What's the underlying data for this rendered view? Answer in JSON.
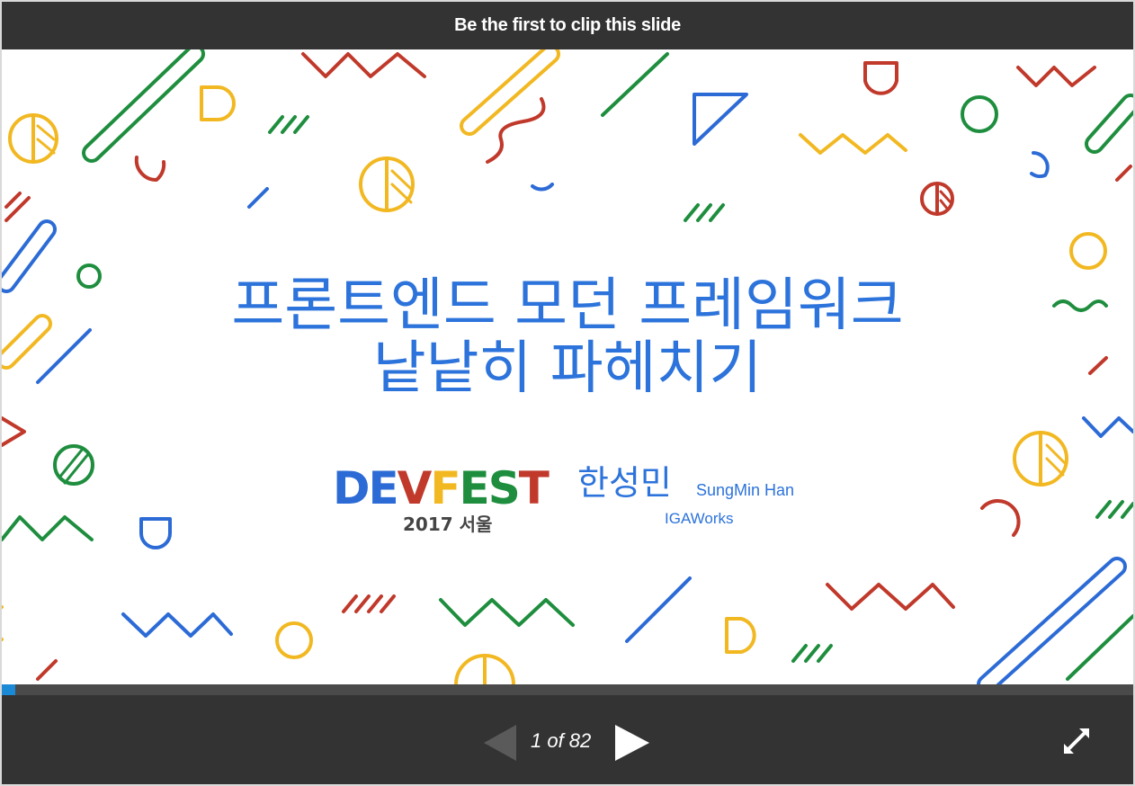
{
  "header": {
    "clip_prompt": "Be the first to clip this slide"
  },
  "slide": {
    "title_line1": "프론트엔드 모던 프레임워크",
    "title_line2": "낱낱히 파헤치기",
    "logo": {
      "word": [
        "D",
        "E",
        "V",
        "F",
        "E",
        "S",
        "T"
      ],
      "year_city": "2017 서울"
    },
    "speaker_name_ko": "한성민",
    "speaker_name_en": "SungMin Han",
    "speaker_company": "IGAWorks"
  },
  "controls": {
    "page_counter": "1 of 82",
    "current_page": 1,
    "total_pages": 82,
    "progress_fraction": 0.0122
  },
  "colors": {
    "title_blue": "#2c73db",
    "google_green": "#1e8e3e",
    "google_red": "#c0392b",
    "google_yellow": "#f2b822",
    "google_blue": "#2c6bd6",
    "progress_blue": "#1a8ad6",
    "chrome_dark": "#333333"
  },
  "icons": {
    "prev": "triangle-left-icon",
    "next": "triangle-right-icon",
    "fullscreen": "expand-arrows-icon"
  }
}
